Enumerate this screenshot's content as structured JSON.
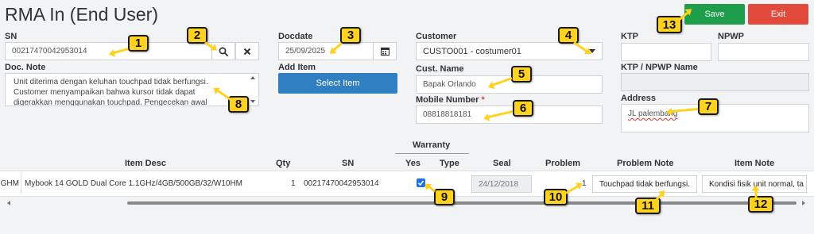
{
  "page_title": "RMA In (End User)",
  "actions": {
    "save_label": "Save",
    "exit_label": "Exit"
  },
  "fields": {
    "sn_label": "SN",
    "sn_value": "00217470042953014",
    "doc_note_label": "Doc. Note",
    "doc_note_value": "Unit diterima dengan keluhan touchpad tidak berfungsi.\nCustomer menyampaikan bahwa kursor tidak dapat\ndigerakkan menggunakan touchpad. Pengecekan awal",
    "docdate_label": "Docdate",
    "docdate_value": "25/09/2025",
    "add_item_label": "Add Item",
    "select_item_label": "Select Item",
    "customer_label": "Customer",
    "customer_value": "CUSTO001 - costumer01",
    "cust_name_label": "Cust. Name",
    "cust_name_value": "Bapak Orlando",
    "mobile_label": "Mobile Number",
    "mobile_required_mark": "*",
    "mobile_value": "08818818181",
    "ktp_label": "KTP",
    "ktp_value": "",
    "npwp_label": "NPWP",
    "npwp_value": "",
    "ktp_npwp_name_label": "KTP / NPWP Name",
    "ktp_npwp_name_value": "",
    "address_label": "Address",
    "address_value": "JL palembang"
  },
  "table": {
    "warranty_group": "Warranty",
    "headers": {
      "item_desc": "Item Desc",
      "qty": "Qty",
      "sn": "SN",
      "yes": "Yes",
      "type": "Type",
      "seal": "Seal",
      "problem": "Problem",
      "problem_note": "Problem Note",
      "item_note": "Item Note"
    },
    "row": {
      "code_fragment": "GHM",
      "item_desc": "Mybook 14 GOLD Dual Core 1.1GHz/4GB/500GB/32/W10HM",
      "qty": "1",
      "sn": "00217470042953014",
      "warranty_yes": true,
      "type": "",
      "seal": "24/12/2018",
      "problem": "1",
      "problem_note": "Touchpad tidak berfungsi.",
      "item_note": "Kondisi fisik unit normal, ta"
    }
  },
  "callouts": [
    "1",
    "2",
    "3",
    "4",
    "5",
    "6",
    "7",
    "8",
    "9",
    "10",
    "11",
    "12",
    "13"
  ],
  "colors": {
    "save": "#1e9e4a",
    "exit": "#e24a3b",
    "select_item": "#2f7fc1",
    "badge": "#ffd21f"
  }
}
